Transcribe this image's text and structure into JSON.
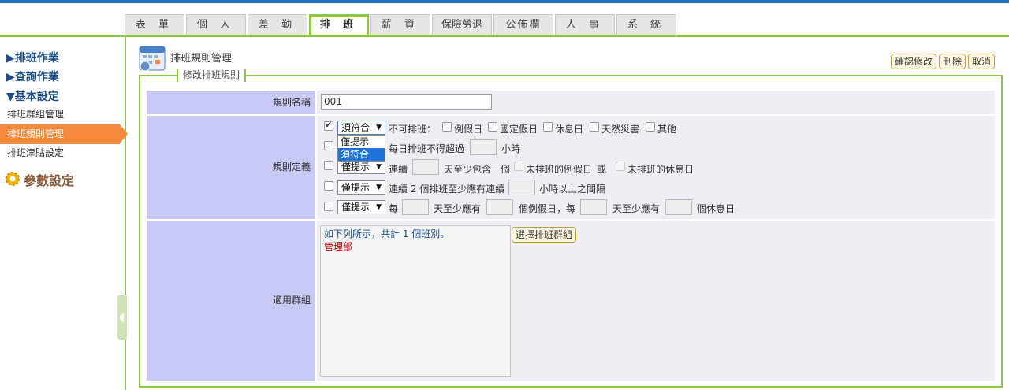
{
  "nav": {
    "tabs": [
      "表 單",
      "個 人",
      "差 勤",
      "排 班",
      "薪 資",
      "保險勞退",
      "公佈欄",
      "人 事",
      "系 統"
    ],
    "active_tab": 3
  },
  "sidebar": {
    "sections": [
      "▶排班作業",
      "▶查詢作業",
      "▼基本設定"
    ],
    "items": [
      "排班群組管理",
      "排班規則管理",
      "排班津貼設定"
    ],
    "active_item": 1,
    "param": "參數設定"
  },
  "page": {
    "title": "排班規則管理",
    "legend": "修改排班規則",
    "buttons": {
      "confirm": "確認修改",
      "delete": "刪除",
      "cancel": "取消"
    }
  },
  "form": {
    "name_label": "規則名稱",
    "name_value": "001",
    "def_label": "規則定義",
    "group_label": "適用群組",
    "select_options": [
      "僅提示",
      "須符合"
    ],
    "dropdown_highlighted": "須符合",
    "rules": [
      {
        "checked": true,
        "select": "須符合",
        "text": "不可排班：",
        "options": [
          "例假日",
          "國定假日",
          "休息日",
          "天然災害",
          "其他"
        ]
      },
      {
        "checked": false,
        "select": "僅提示",
        "parts": [
          "每日排班不得超過",
          "小時"
        ]
      },
      {
        "checked": false,
        "select": "僅提示",
        "parts": [
          "連續",
          "天至少包含一個",
          "未排班的例假日",
          "或",
          "未排班的休息日"
        ]
      },
      {
        "checked": false,
        "select": "僅提示",
        "parts": [
          "連續 2 個排班至少應有連續",
          "小時以上之間隔"
        ]
      },
      {
        "checked": false,
        "select": "僅提示",
        "parts": [
          "每",
          "天至少應有",
          "個例假日，每",
          "天至少應有",
          "個休息日"
        ]
      }
    ],
    "group_summary": "如下列所示，共計 1 個班別。",
    "groups": [
      "管理部"
    ],
    "choose_group_button": "選擇排班群組"
  },
  "colors": {
    "accent": "#8dc63f",
    "active_item": "#f58a3c",
    "label_bg": "#c9c9f5",
    "value_bg": "#efeef5"
  }
}
